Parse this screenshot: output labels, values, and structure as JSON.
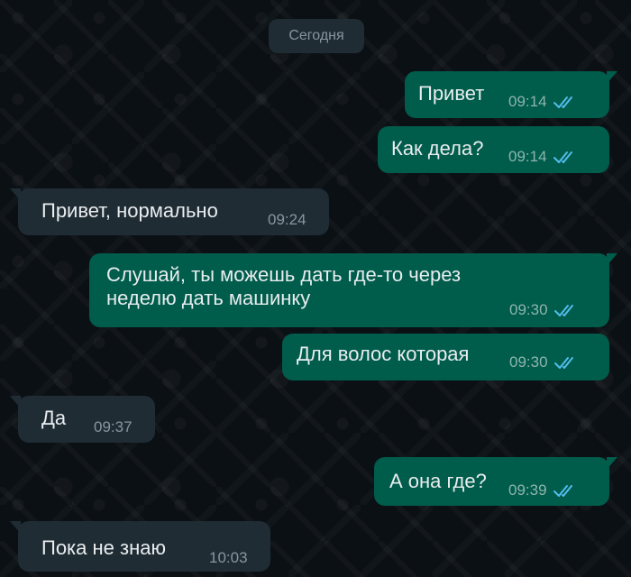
{
  "date_divider": "Сегодня",
  "messages": [
    {
      "direction": "out",
      "text": "Привет",
      "time": "09:14",
      "status": "read"
    },
    {
      "direction": "out",
      "text": "Как дела?",
      "time": "09:14",
      "status": "read"
    },
    {
      "direction": "in",
      "text": "Привет, нормально",
      "time": "09:24"
    },
    {
      "direction": "out",
      "text_line1": "Слушай, ты  можешь дать где-то через",
      "text_line2": "неделю дать машинку",
      "time": "09:30",
      "status": "read"
    },
    {
      "direction": "out",
      "text": "Для волос которая",
      "time": "09:30",
      "status": "read"
    },
    {
      "direction": "in",
      "text": "Да",
      "time": "09:37"
    },
    {
      "direction": "out",
      "text": "А она где?",
      "time": "09:39",
      "status": "read"
    },
    {
      "direction": "in",
      "text": "Пока не знаю",
      "time": "10:03"
    }
  ],
  "colors": {
    "background": "#0b1014",
    "outgoing_bubble": "#005c4b",
    "incoming_bubble": "#1f2c34",
    "read_ticks": "#53bdeb",
    "date_chip": "#1f2c34"
  },
  "icons": {
    "read_receipt": "double-check-icon"
  }
}
